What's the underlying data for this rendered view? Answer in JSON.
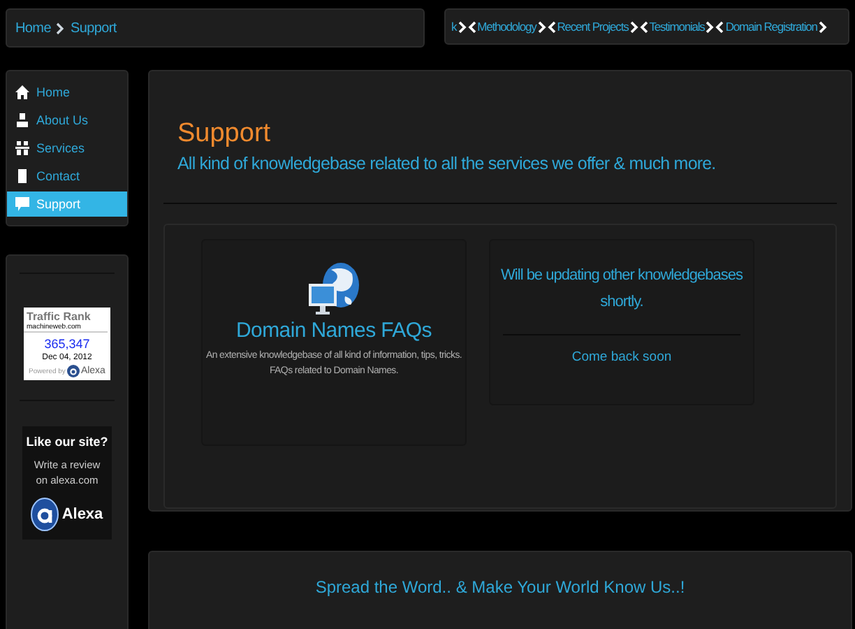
{
  "breadcrumb": {
    "items": [
      {
        "label": "Home"
      },
      {
        "label": "Support"
      }
    ]
  },
  "top_links": [
    "k",
    "Methodology",
    "Recent Projects",
    "Testimonials",
    "Domain Registration"
  ],
  "nav": [
    {
      "label": "Home",
      "kind": "home",
      "selected": false
    },
    {
      "label": "About Us",
      "kind": "person",
      "selected": false
    },
    {
      "label": "Services",
      "kind": "gift",
      "selected": false
    },
    {
      "label": "Contact",
      "kind": "document",
      "selected": false
    },
    {
      "label": "Support",
      "kind": "comment",
      "selected": true
    }
  ],
  "traffic_widget": {
    "title": "Traffic Rank",
    "site": "machineweb.com",
    "rank": "365,347",
    "date": "Dec 04, 2012",
    "powered_by": "Powered by",
    "brand": "Alexa"
  },
  "review_widget": {
    "title": "Like our site?",
    "text": "Write a review on alexa.com",
    "brand": "Alexa"
  },
  "page": {
    "title": "Support",
    "subtitle": "All kind of knowledgebase related to all the services we offer & much more."
  },
  "cards": [
    {
      "kind": "feature",
      "title": "Domain Names FAQs",
      "text": "An extensive knowledgebase of all kind of information, tips, tricks. FAQs related to Domain Names."
    },
    {
      "kind": "notice",
      "title": "Will be updating other knowledgebases shortly.",
      "text": "Come back soon"
    }
  ],
  "footer_banner": "Spread the Word.. & Make Your World Know Us..!"
}
